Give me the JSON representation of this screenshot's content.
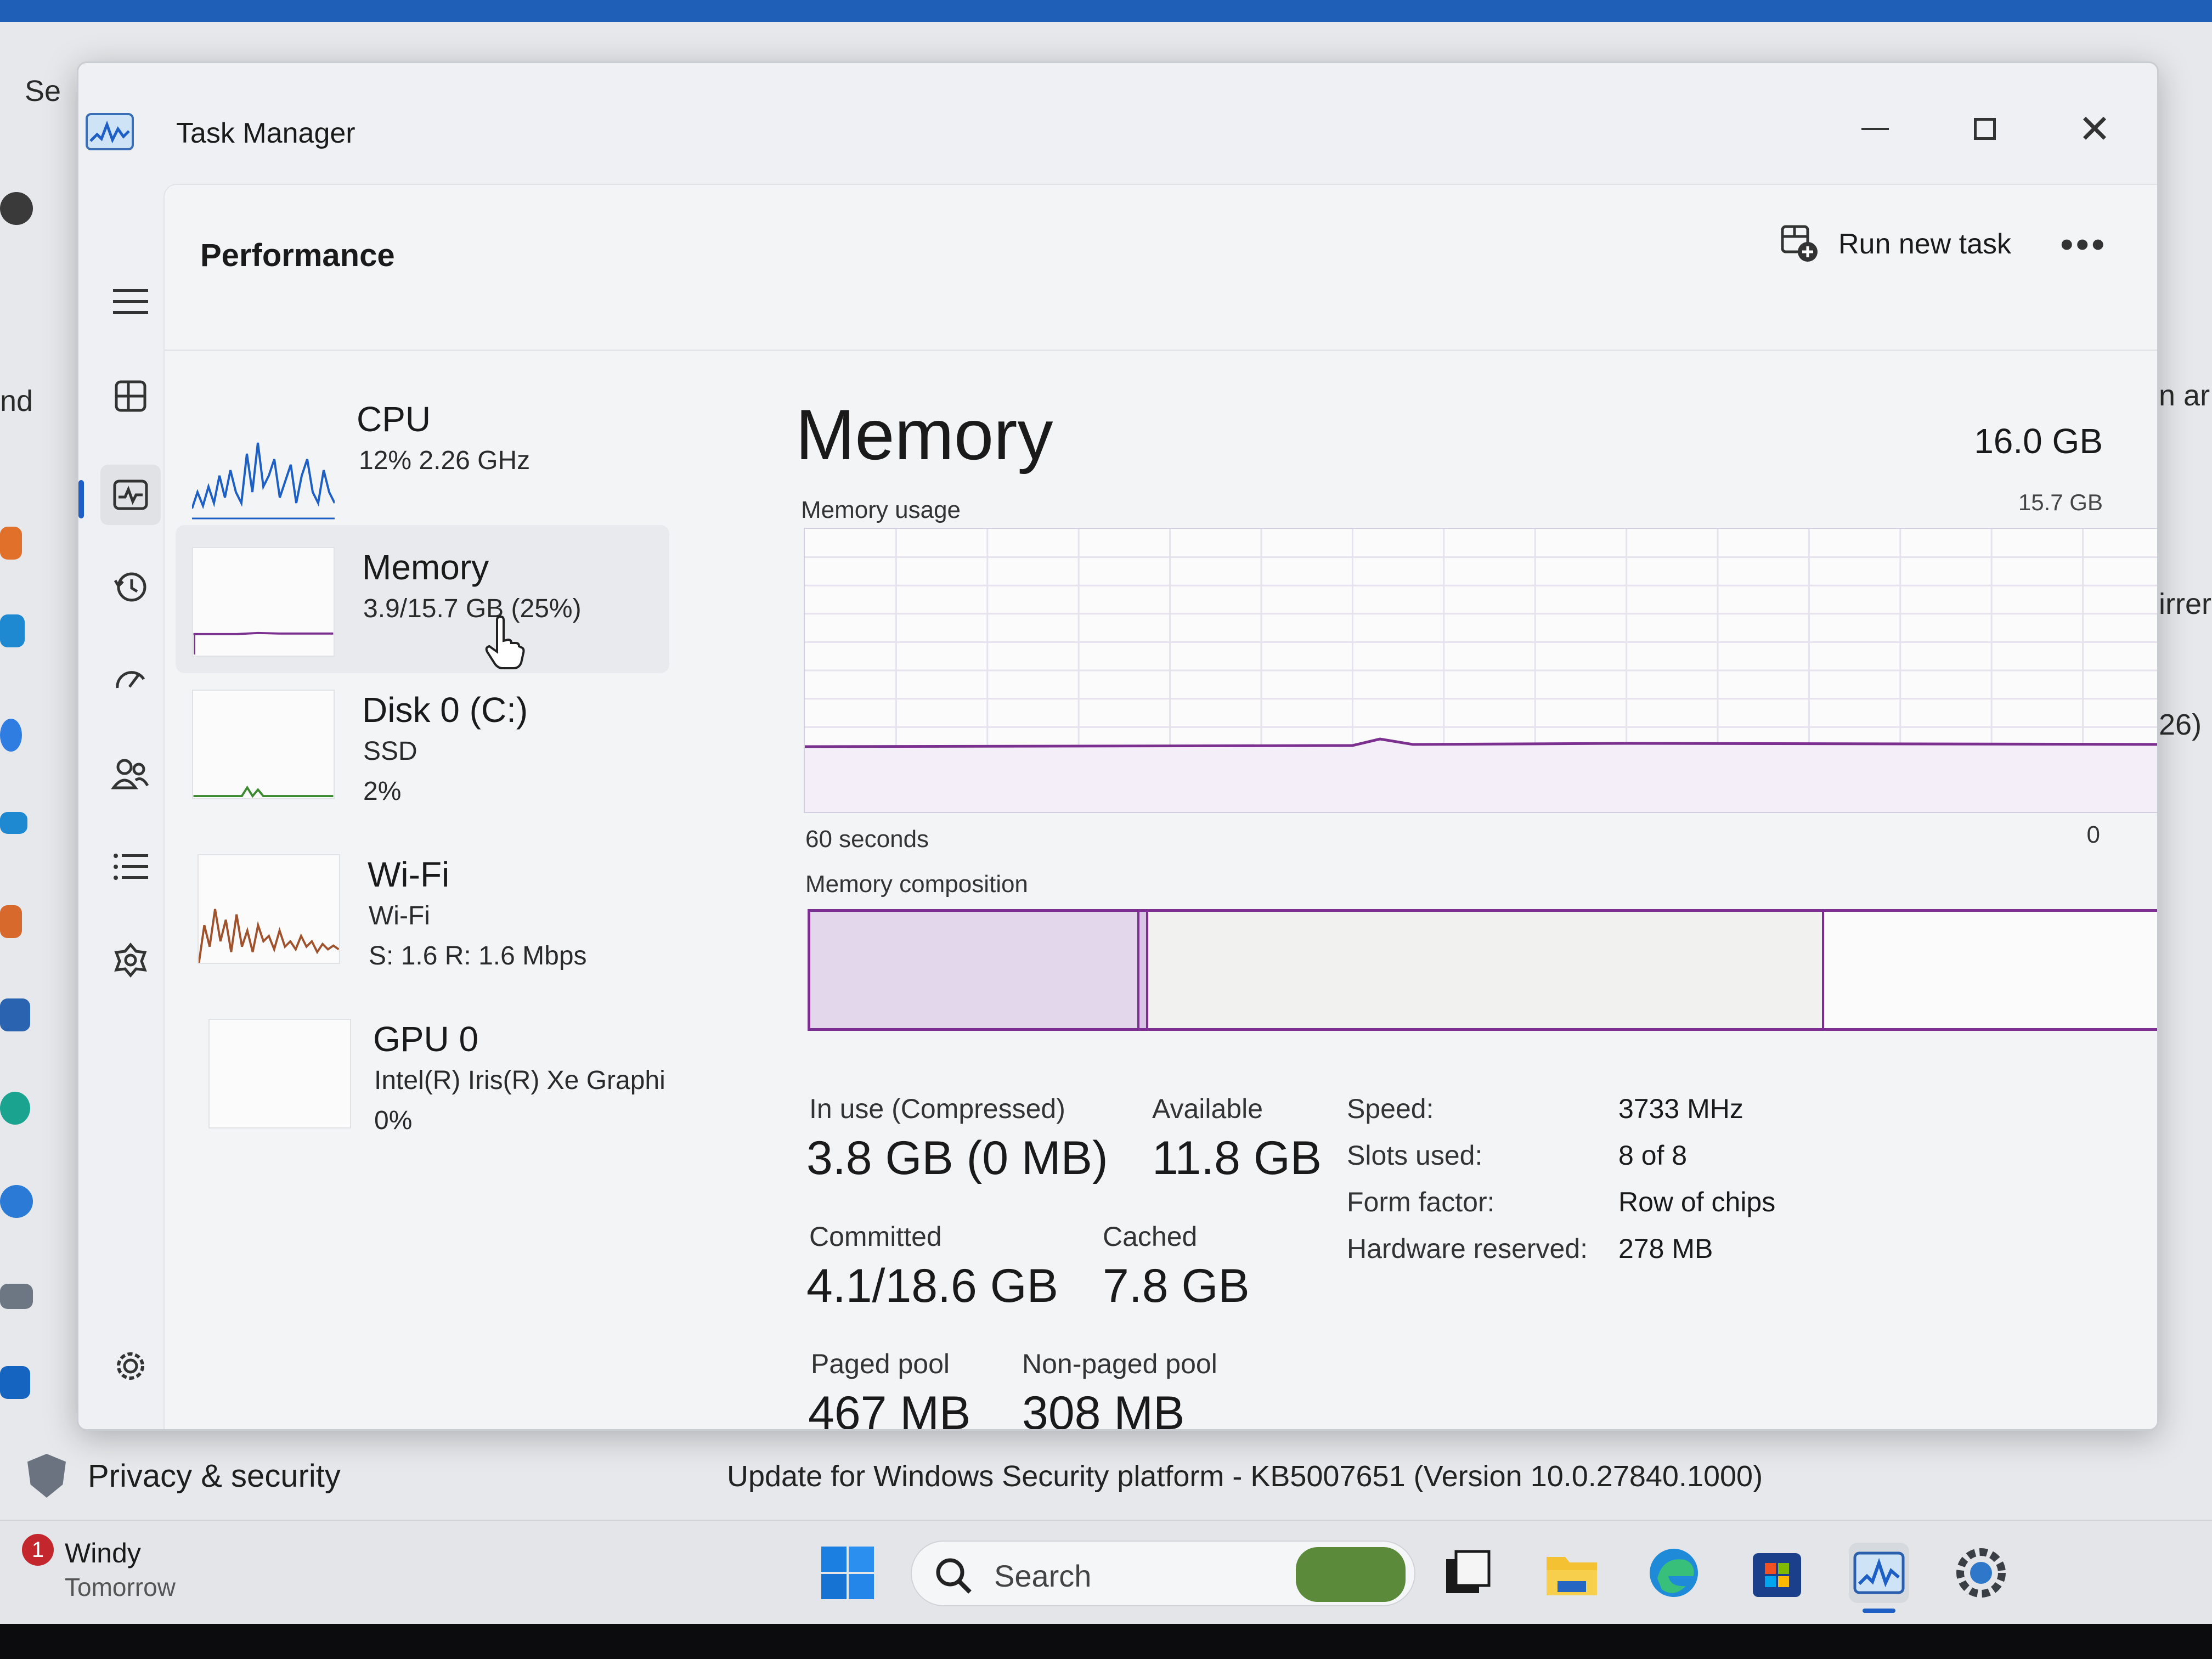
{
  "window": {
    "title": "Task Manager"
  },
  "header": {
    "page_title": "Performance",
    "run_new_task": "Run new task",
    "more": "•••"
  },
  "devices": [
    {
      "name": "CPU",
      "line1": "12%  2.26 GHz",
      "line2": ""
    },
    {
      "name": "Memory",
      "line1": "3.9/15.7 GB (25%)",
      "line2": ""
    },
    {
      "name": "Disk 0 (C:)",
      "line1": "SSD",
      "line2": "2%"
    },
    {
      "name": "Wi-Fi",
      "line1": "Wi-Fi",
      "line2": "S: 1.6  R: 1.6 Mbps"
    },
    {
      "name": "GPU 0",
      "line1": "Intel(R) Iris(R) Xe Graphi",
      "line2": "0%"
    }
  ],
  "memory": {
    "title": "Memory",
    "total": "16.0 GB",
    "usage_label": "Memory usage",
    "usage_max": "15.7 GB",
    "time_span": "60 seconds",
    "time_zero": "0",
    "composition_label": "Memory composition",
    "usage_level_fraction": 0.25,
    "composition": {
      "in_use_gb": 3.8,
      "modified_gb": 0.1,
      "standby_gb": 7.8,
      "free_gb": 4.0
    },
    "stats": {
      "in_use_label": "In use (Compressed)",
      "in_use_value": "3.8 GB (0 MB)",
      "available_label": "Available",
      "available_value": "11.8 GB",
      "committed_label": "Committed",
      "committed_value": "4.1/18.6 GB",
      "cached_label": "Cached",
      "cached_value": "7.8 GB",
      "paged_label": "Paged pool",
      "paged_value": "467 MB",
      "nonpaged_label": "Non-paged pool",
      "nonpaged_value": "308 MB"
    },
    "properties": [
      {
        "key": "Speed:",
        "value": "3733 MHz"
      },
      {
        "key": "Slots used:",
        "value": "8 of 8"
      },
      {
        "key": "Form factor:",
        "value": "Row of chips"
      },
      {
        "key": "Hardware reserved:",
        "value": "278 MB"
      }
    ]
  },
  "background": {
    "frag_top": "Se",
    "frag_nd": "nd",
    "frag_right1": "n ar",
    "frag_right2": "irrer",
    "frag_right3": "26)",
    "privacy": "Privacy & security",
    "update": "Update for Windows Security platform - KB5007651 (Version 10.0.27840.1000)"
  },
  "taskbar": {
    "weather_badge": "1",
    "weather_line1": "Windy",
    "weather_line2": "Tomorrow",
    "search": "Search"
  },
  "colors": {
    "memory_purple": "#7b2f8e",
    "accent_blue": "#1d5fc4"
  }
}
